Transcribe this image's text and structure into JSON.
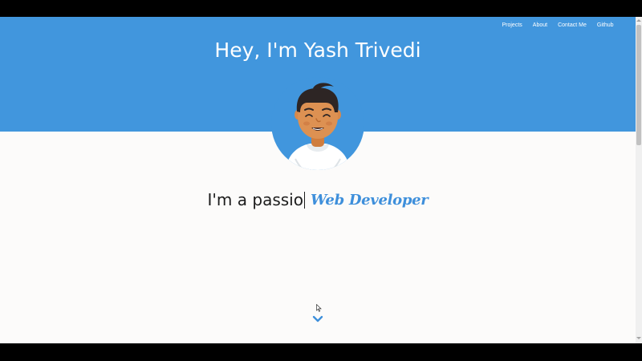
{
  "nav": {
    "items": [
      {
        "label": "Projects"
      },
      {
        "label": "About"
      },
      {
        "label": "Contact Me"
      },
      {
        "label": "Github"
      }
    ]
  },
  "hero": {
    "title": "Hey, I'm Yash Trivedi"
  },
  "tagline": {
    "typed_text": "I'm a passio",
    "role": "Web Developer"
  },
  "icons": {
    "avatar": "avatar-illustration",
    "scroll": "chevron-down-icon",
    "pointer": "mouse-pointer-icon"
  },
  "colors": {
    "hero_background": "#4196dd",
    "accent": "#3e8fdb",
    "page_background": "#fcfbfa",
    "text": "#1c1c1c"
  }
}
